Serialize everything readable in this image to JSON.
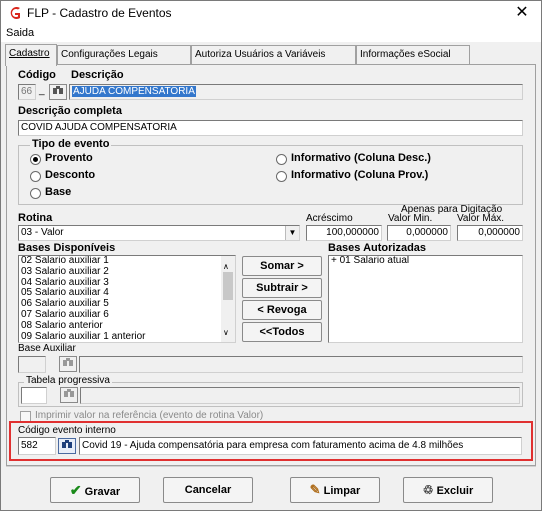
{
  "window": {
    "title": "FLP - Cadastro de Eventos",
    "close_glyph": "✕"
  },
  "menu": {
    "saida": "Saida"
  },
  "tabs": [
    {
      "label": "Cadastro"
    },
    {
      "label": "Configurações Legais"
    },
    {
      "label": "Autoriza Usuários a Variáveis"
    },
    {
      "label": "Informações eSocial"
    }
  ],
  "codigo": {
    "label": "Código",
    "value": "66",
    "underscore": "_"
  },
  "descricao": {
    "label": "Descrição",
    "value": "AJUDA COMPENSATORIA"
  },
  "descricao_completa": {
    "label": "Descrição completa",
    "value": "COVID AJUDA COMPENSATORIA"
  },
  "tipo_evento": {
    "label": "Tipo de evento",
    "options": [
      {
        "label": "Provento",
        "selected": true
      },
      {
        "label": "Desconto",
        "selected": false
      },
      {
        "label": "Base",
        "selected": false
      },
      {
        "label": "Informativo (Coluna Desc.)",
        "selected": false
      },
      {
        "label": "Informativo (Coluna Prov.)",
        "selected": false
      }
    ]
  },
  "rotina": {
    "label": "Rotina",
    "value": "03 - Valor"
  },
  "apenas_digitacao": "Apenas para Digitação",
  "acrescimo": {
    "label": "Acréscimo",
    "value": "100,000000"
  },
  "valor_min": {
    "label": "Valor Min.",
    "value": "0,000000"
  },
  "valor_max": {
    "label": "Valor Máx.",
    "value": "0,000000"
  },
  "bases_disponiveis": {
    "label": "Bases Disponíveis",
    "items": [
      "02 Salario auxiliar 1",
      "03 Salario auxiliar 2",
      "04 Salario auxiliar 3",
      "05 Salario auxiliar 4",
      "06 Salario auxiliar 5",
      "07 Salario auxiliar 6",
      "08 Salario anterior",
      "09 Salario auxiliar 1 anterior"
    ]
  },
  "bases_autorizadas": {
    "label": "Bases Autorizadas",
    "items": [
      "+ 01 Salario atual"
    ]
  },
  "buttons_mid": {
    "somar": "Somar >",
    "subtrair": "Subtrair >",
    "revoga": "< Revoga",
    "todos": "<<Todos"
  },
  "base_auxiliar": {
    "label": "Base Auxiliar",
    "value": ""
  },
  "tabela_progressiva": {
    "label": "Tabela progressiva",
    "value": ""
  },
  "imprimir_valor": {
    "label": "Imprimir valor na referência (evento de rotina Valor)",
    "checked": false
  },
  "codigo_evento_interno": {
    "label": "Código evento interno",
    "code": "582",
    "description": "Covid 19 - Ajuda compensatória para empresa com faturamento acima de 4.8 milhões"
  },
  "footer": {
    "gravar": "Gravar",
    "cancelar": "Cancelar",
    "limpar": "Limpar",
    "excluir": "Excluir"
  },
  "colors": {
    "accent_red": "#e03030",
    "selection": "#3377cc",
    "window_bg": "#f0f0f0"
  }
}
